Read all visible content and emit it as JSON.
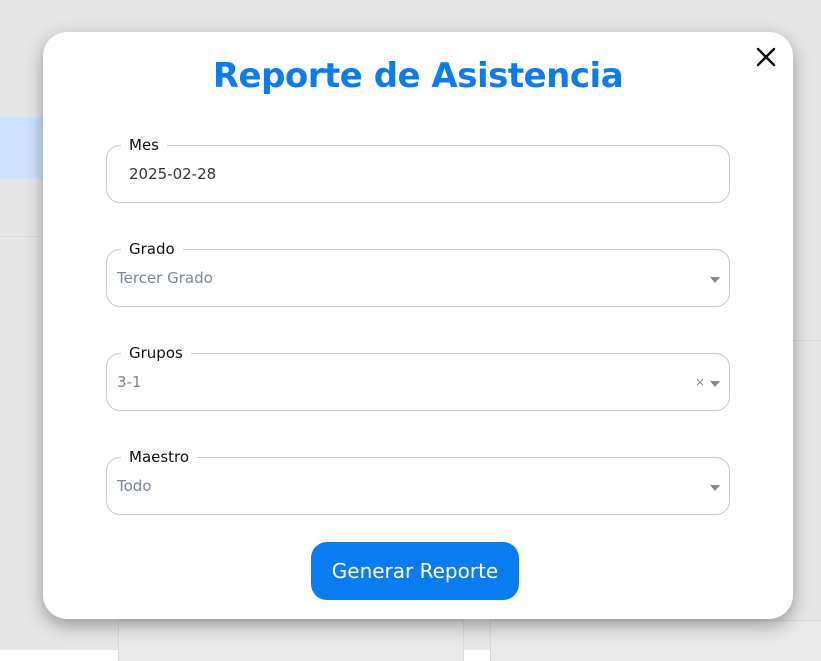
{
  "modal": {
    "title": "Reporte de Asistencia",
    "close_icon": "close-icon"
  },
  "form": {
    "mes": {
      "label": "Mes",
      "value": "2025-02-28"
    },
    "grado": {
      "label": "Grado",
      "value": "Tercer Grado"
    },
    "grupos": {
      "label": "Grupos",
      "value": "3-1",
      "clear": "×"
    },
    "maestro": {
      "label": "Maestro",
      "value": "Todo"
    },
    "submit_label": "Generar Reporte"
  },
  "colors": {
    "accent": "#0a7cf2",
    "placeholder": "#7a8799",
    "border": "#c8c8c8"
  }
}
